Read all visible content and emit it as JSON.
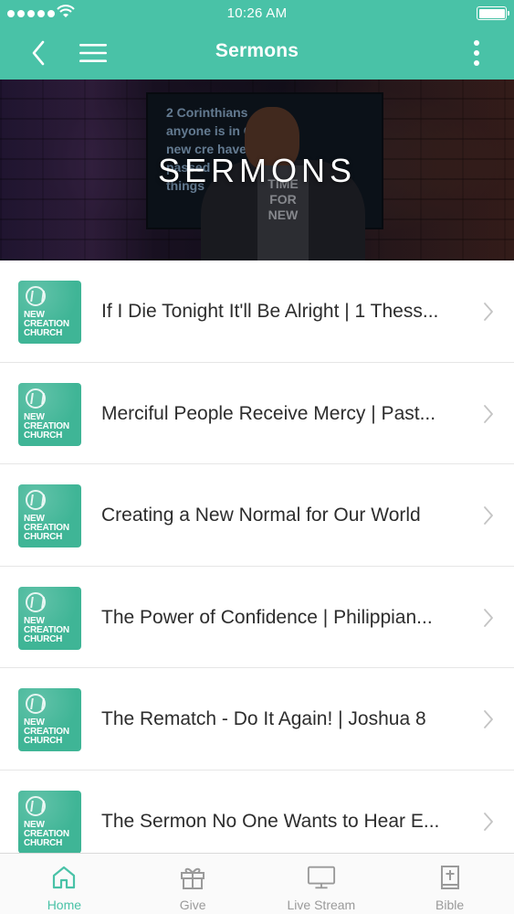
{
  "status": {
    "time": "10:26 AM"
  },
  "nav": {
    "title": "Sermons"
  },
  "hero": {
    "title": "SERMONS",
    "screen_text": [
      "2 Corinthians",
      "anyone is in C  is a",
      "new cre   have",
      "passed",
      "things"
    ],
    "shirt_text": [
      "TIME",
      "FOR",
      "NEW"
    ]
  },
  "thumb": {
    "logo_lines": [
      "NEW",
      "CREATION",
      "CHURCH"
    ]
  },
  "sermons": [
    {
      "title": "If I Die Tonight It'll Be Alright | 1 Thess..."
    },
    {
      "title": "Merciful People Receive Mercy | Past..."
    },
    {
      "title": "Creating a New Normal for Our World"
    },
    {
      "title": "The Power of Confidence | Philippian..."
    },
    {
      "title": "The Rematch - Do It Again! | Joshua 8"
    },
    {
      "title": "The Sermon No One Wants to Hear E..."
    }
  ],
  "tabs": [
    {
      "label": "Home",
      "icon": "home-icon",
      "active": true
    },
    {
      "label": "Give",
      "icon": "gift-icon",
      "active": false
    },
    {
      "label": "Live Stream",
      "icon": "monitor-icon",
      "active": false
    },
    {
      "label": "Bible",
      "icon": "bible-icon",
      "active": false
    }
  ],
  "colors": {
    "accent": "#49c2a7",
    "thumb": "#3fb596",
    "tab_inactive": "#9a9a9a",
    "text": "#2d2d2d"
  }
}
